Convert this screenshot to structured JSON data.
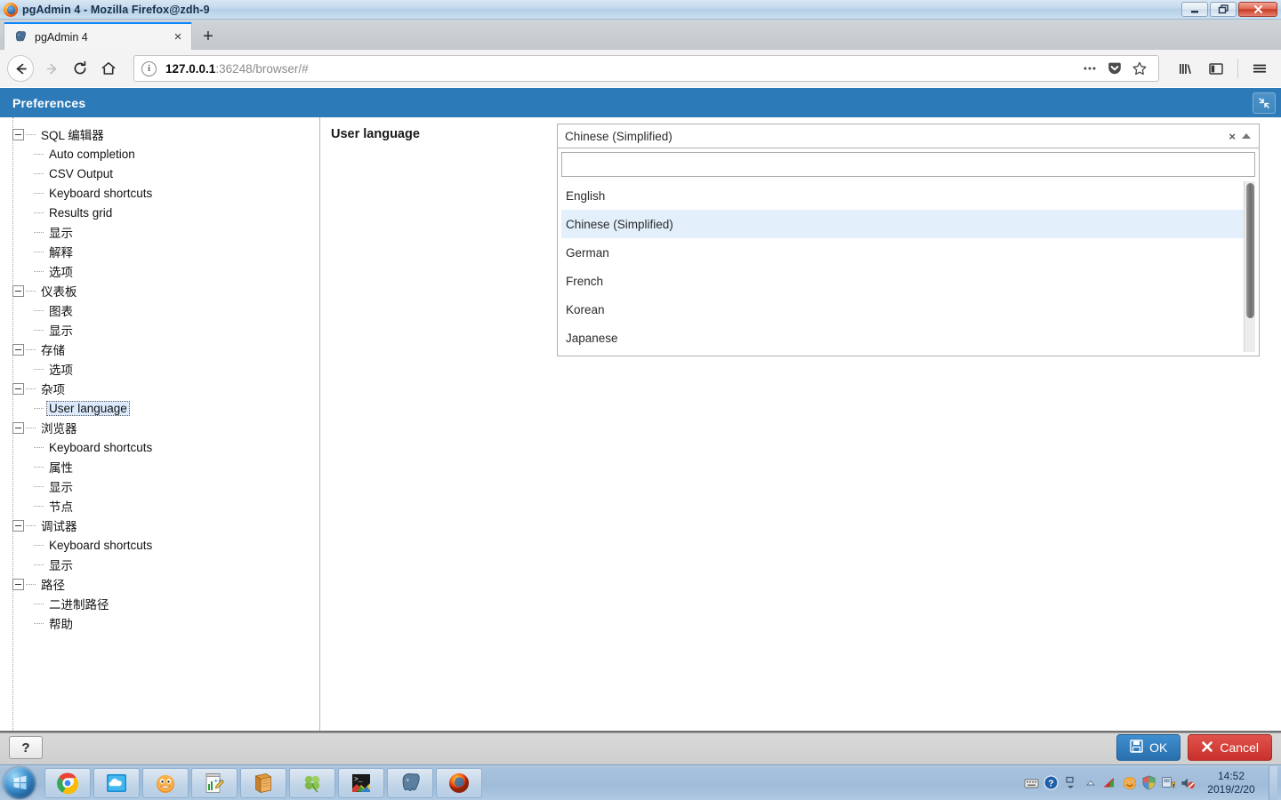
{
  "window": {
    "title": "pgAdmin 4 - Mozilla Firefox@zdh-9",
    "minimize_label": "Minimize",
    "restore_label": "Restore",
    "close_label": "Close"
  },
  "browser": {
    "tab": {
      "label": "pgAdmin 4",
      "close_label": "×",
      "favicon": "postgres-elephant-icon"
    },
    "new_tab_label": "+",
    "nav": {
      "back_label": "Back",
      "forward_label": "Forward",
      "reload_label": "Reload",
      "home_label": "Home"
    },
    "url": {
      "host": "127.0.0.1",
      "rest": ":36248/browser/#",
      "info_glyph": "i"
    },
    "urlbar_icons": [
      "page-actions-icon",
      "pocket-icon",
      "bookmark-star-icon"
    ],
    "right_icons": [
      "library-icon",
      "sidebar-icon",
      "hamburger-menu-icon"
    ]
  },
  "preferences": {
    "title": "Preferences",
    "restore_icon": "shrink-arrows-icon"
  },
  "tree": [
    {
      "label": "SQL 编辑器",
      "level": 0,
      "expanded": true,
      "selected": false
    },
    {
      "label": "Auto completion",
      "level": 1,
      "expanded": false,
      "selected": false
    },
    {
      "label": "CSV Output",
      "level": 1,
      "expanded": false,
      "selected": false
    },
    {
      "label": "Keyboard shortcuts",
      "level": 1,
      "expanded": false,
      "selected": false
    },
    {
      "label": "Results grid",
      "level": 1,
      "expanded": false,
      "selected": false
    },
    {
      "label": "显示",
      "level": 1,
      "expanded": false,
      "selected": false
    },
    {
      "label": "解释",
      "level": 1,
      "expanded": false,
      "selected": false
    },
    {
      "label": "选项",
      "level": 1,
      "expanded": false,
      "selected": false
    },
    {
      "label": "仪表板",
      "level": 0,
      "expanded": true,
      "selected": false
    },
    {
      "label": "图表",
      "level": 1,
      "expanded": false,
      "selected": false
    },
    {
      "label": "显示",
      "level": 1,
      "expanded": false,
      "selected": false
    },
    {
      "label": "存储",
      "level": 0,
      "expanded": true,
      "selected": false
    },
    {
      "label": "选项",
      "level": 1,
      "expanded": false,
      "selected": false
    },
    {
      "label": "杂项",
      "level": 0,
      "expanded": true,
      "selected": false
    },
    {
      "label": "User language",
      "level": 1,
      "expanded": false,
      "selected": true
    },
    {
      "label": "浏览器",
      "level": 0,
      "expanded": true,
      "selected": false
    },
    {
      "label": "Keyboard shortcuts",
      "level": 1,
      "expanded": false,
      "selected": false
    },
    {
      "label": "属性",
      "level": 1,
      "expanded": false,
      "selected": false
    },
    {
      "label": "显示",
      "level": 1,
      "expanded": false,
      "selected": false
    },
    {
      "label": "节点",
      "level": 1,
      "expanded": false,
      "selected": false
    },
    {
      "label": "调试器",
      "level": 0,
      "expanded": true,
      "selected": false
    },
    {
      "label": "Keyboard shortcuts",
      "level": 1,
      "expanded": false,
      "selected": false
    },
    {
      "label": "显示",
      "level": 1,
      "expanded": false,
      "selected": false
    },
    {
      "label": "路径",
      "level": 0,
      "expanded": true,
      "selected": false
    },
    {
      "label": "二进制路径",
      "level": 1,
      "expanded": false,
      "selected": false
    },
    {
      "label": "帮助",
      "level": 1,
      "expanded": false,
      "selected": false
    }
  ],
  "field": {
    "label": "User language",
    "selected_value": "Chinese (Simplified)",
    "clear_label": "×",
    "search_value": "",
    "search_placeholder": "",
    "options": [
      {
        "label": "English",
        "highlighted": false
      },
      {
        "label": "Chinese (Simplified)",
        "highlighted": true
      },
      {
        "label": "German",
        "highlighted": false
      },
      {
        "label": "French",
        "highlighted": false
      },
      {
        "label": "Korean",
        "highlighted": false
      },
      {
        "label": "Japanese",
        "highlighted": false
      }
    ]
  },
  "footer": {
    "help_label": "?",
    "ok_label": "OK",
    "cancel_label": "Cancel"
  },
  "taskbar": {
    "start_label": "Start",
    "items": [
      "chrome-icon",
      "onedrive-icon",
      "orange-face-icon",
      "notepadpp-icon",
      "book-icon",
      "clover-icon",
      "terminal-icon",
      "postgresql-icon",
      "firefox-icon"
    ],
    "tray": [
      "keyboard-icon",
      "help-question-icon",
      "show-hidden-icons-icon",
      "up-arrow-icon",
      "network-signal-icon",
      "face-icon",
      "security-shield-icon",
      "action-center-icon",
      "volume-muted-icon"
    ],
    "clock": {
      "time": "14:52",
      "date": "2019/2/20"
    }
  },
  "colors": {
    "header_blue": "#2c7ab8",
    "ok_blue": "#2a6fad",
    "cancel_red": "#c9302c",
    "highlight_blue": "#e3f0fb",
    "tab_accent": "#0a84ff"
  }
}
